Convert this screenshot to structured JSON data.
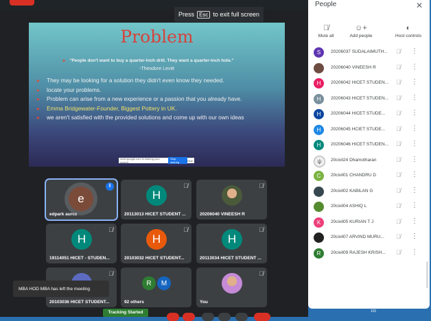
{
  "fullscreen_banner": {
    "before": "Press",
    "key": "Esc",
    "after": "to exit full screen"
  },
  "slide": {
    "title": "Problem",
    "quote": "\"People don't want to buy a quarter-inch drill. They want a quarter-inch hole.\"",
    "author": "-Theodore Levitt",
    "bullets": [
      {
        "text": "They may be looking for a solution they didn't even know they needed.",
        "hl": false
      },
      {
        "text": "locate your problems.",
        "hl": false
      },
      {
        "text": "Problem can arise from a new experience or a passion that you already have.",
        "hl": false
      },
      {
        "text": "Emma Bridgewater-Founder, Biggest Pottery in UK.",
        "hl": true
      },
      {
        "text": "we aren't satisfied with the provided solutions and come up with our own ideas",
        "hl": false
      }
    ],
    "share_bar": {
      "text": "meet.google.com is sharing your screen.",
      "stop": "Stop sharing",
      "hide": "Hide"
    }
  },
  "tiles": [
    {
      "name": "edpark aurcc",
      "initial": "e",
      "color": "#7b4b3a",
      "active": true
    },
    {
      "name": "20113013 HICET STUDENT ...",
      "initial": "H",
      "color": "#00897b"
    },
    {
      "name": "20206040 VINEESH R",
      "initial": "",
      "color": "#4a5a3a",
      "photo": true
    },
    {
      "name": "19114051 HICET - STUDEN...",
      "initial": "H",
      "color": "#00897b"
    },
    {
      "name": "20103032 HICET STUDENT...",
      "initial": "H",
      "color": "#e8590c"
    },
    {
      "name": "20113034 HICET STUDENT ...",
      "initial": "H",
      "color": "#00897b"
    },
    {
      "name": "20103036 HICET STUDENT...",
      "initial": "",
      "color": "#5c6bc0"
    },
    {
      "name": "92 others",
      "initial": "",
      "color": "#3c4043",
      "others": [
        "R",
        "M"
      ]
    },
    {
      "name": "You",
      "initial": "",
      "color": "#c58bd6",
      "photo": true
    }
  ],
  "toast": "MBA HOD MBA has left the meeting",
  "tracking": "Tracking Started",
  "panel": {
    "title": "People",
    "actions": [
      "Mute all",
      "Add people",
      "Host controls"
    ],
    "participants": [
      {
        "initial": "S",
        "color": "#5e35b1",
        "name": "20206037 SUDALAIMUTH..."
      },
      {
        "initial": "",
        "color": "#6d4c41",
        "name": "20206040 VINEESH R"
      },
      {
        "initial": "H",
        "color": "#e91e63",
        "name": "20206042 HICET STUDEN..."
      },
      {
        "initial": "H",
        "color": "#78909c",
        "name": "20206043 HICET STUDEN..."
      },
      {
        "initial": "H",
        "color": "#0d47a1",
        "name": "20206044 HICET STUDE..."
      },
      {
        "initial": "H",
        "color": "#1e88e5",
        "name": "20206045 HCIET STUDE..."
      },
      {
        "initial": "H",
        "color": "#00897b",
        "name": "20206046 HICET STUDEN..."
      },
      {
        "initial": "",
        "color": "#eeeeee",
        "name": "20civil24 Dhamotharan"
      },
      {
        "initial": "C",
        "color": "#7cb342",
        "name": "20civil01 CHANDRU D"
      },
      {
        "initial": "",
        "color": "#37474f",
        "name": "20civil02 KABILAN G"
      },
      {
        "initial": "",
        "color": "#558b2f",
        "name": "20civil04 ASHIQ L"
      },
      {
        "initial": "K",
        "color": "#ec407a",
        "name": "20civil05 KURIAN T J"
      },
      {
        "initial": "",
        "color": "#212121",
        "name": "20civil07 ARVIND MURU..."
      },
      {
        "initial": "R",
        "color": "#2e7d32",
        "name": "20civil09 RAJESH KRISH..."
      }
    ]
  },
  "bottom_number": "101"
}
